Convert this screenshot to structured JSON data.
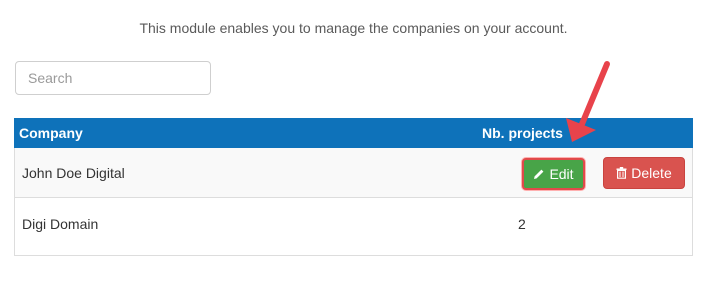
{
  "intro_text": "This module enables you to manage the companies on your account.",
  "search": {
    "placeholder": "Search",
    "value": ""
  },
  "table": {
    "headers": {
      "company": "Company",
      "projects": "Nb. projects"
    },
    "rows": [
      {
        "company": "John Doe Digital",
        "projects": "",
        "edit_label": "Edit",
        "delete_label": "Delete"
      },
      {
        "company": "Digi Domain",
        "projects": "2"
      }
    ]
  },
  "colors": {
    "header_bg": "#0e72ba",
    "edit_bg": "#48a448",
    "delete_bg": "#d9534f",
    "annotation_red": "#e8434b"
  },
  "icons": {
    "edit": "pencil-icon",
    "delete": "trash-icon",
    "annotation": "red-arrow-icon"
  }
}
